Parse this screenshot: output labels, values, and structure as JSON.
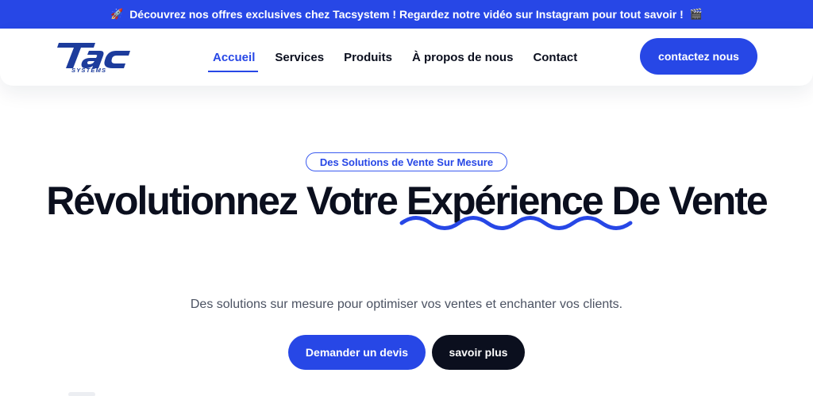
{
  "announcement": {
    "icon": "rocket-icon",
    "text": "Découvrez nos offres exclusives chez Tacsystem ! Regardez notre vidéo sur Instagram pour tout savoir !",
    "trailing_icon": "clapperboard-icon",
    "background": "#2747e6"
  },
  "header": {
    "logo": {
      "main": "TAC",
      "sub": "SYSTEMS"
    },
    "nav": [
      {
        "label": "Accueil",
        "active": true
      },
      {
        "label": "Services",
        "active": false
      },
      {
        "label": "Produits",
        "active": false
      },
      {
        "label": "À propos de nous",
        "active": false
      },
      {
        "label": "Contact",
        "active": false
      }
    ],
    "cta_label": "contactez nous"
  },
  "hero": {
    "badge": "Des Solutions de Vente Sur Mesure",
    "headline_before": "Révolutionnez Votre ",
    "headline_highlight": "Expérience",
    "headline_after": " De Vente",
    "subtitle": "Des solutions sur mesure pour optimiser vos ventes et enchanter vos clients.",
    "primary_button": "Demander un devis",
    "secondary_button": "savoir plus"
  },
  "colors": {
    "accent": "#2747e6",
    "dark": "#0b0f1e",
    "text_muted": "#4b5262"
  }
}
